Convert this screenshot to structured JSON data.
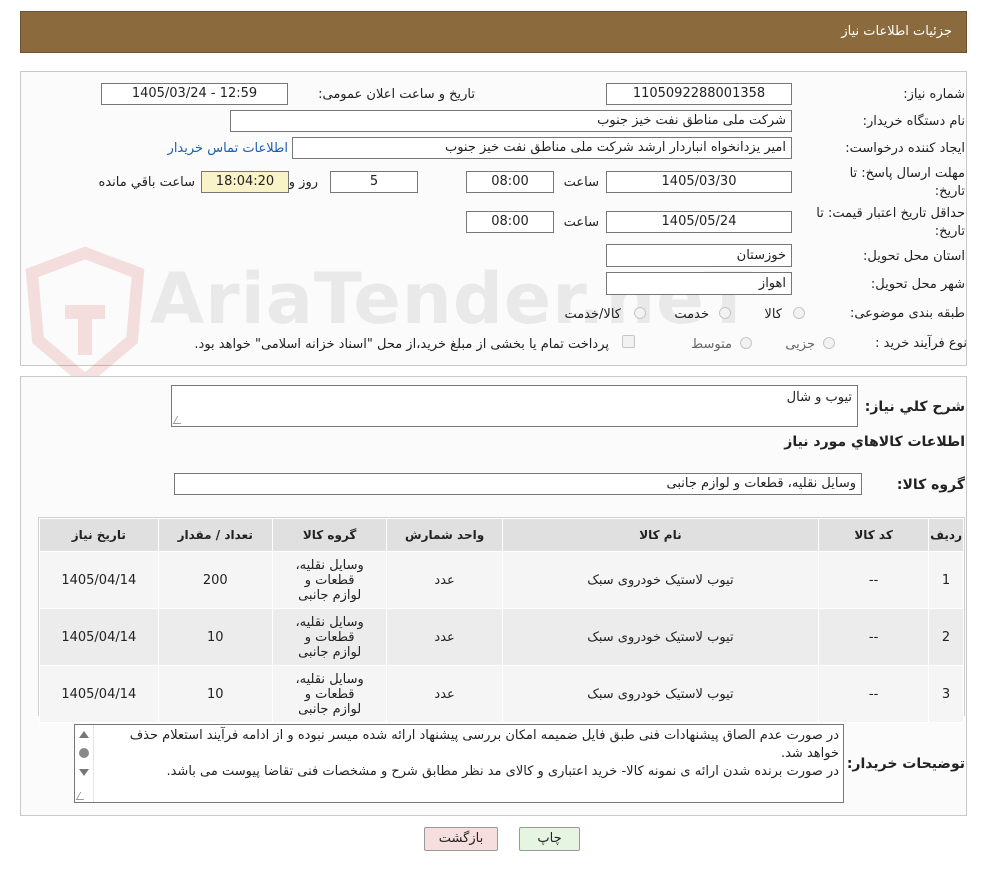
{
  "header": {
    "title": "جزئیات اطلاعات نیاز"
  },
  "fields": {
    "need_number_label": "شماره نیاز:",
    "need_number": "1105092288001358",
    "announce_label": "تاریخ و ساعت اعلان عمومی:",
    "announce_value": "1405/03/24 - 12:59",
    "buyer_label": "نام دستگاه خریدار:",
    "buyer_value": "شرکت ملی مناطق نفت خیز جنوب",
    "creator_label": "ایجاد کننده درخواست:",
    "creator_value": "امیر یزدانخواه انباردار ارشد شرکت ملی مناطق نفت خیز جنوب",
    "contact_link": "اطلاعات تماس خریدار",
    "deadline_label_1": "مهلت ارسال پاسخ: تا",
    "deadline_label_2": "تاریخ:",
    "deadline_date": "1405/03/30",
    "time_label": "ساعت",
    "deadline_time": "08:00",
    "days_value": "5",
    "days_label": "روز و",
    "remaining_time": "18:04:20",
    "remaining_label": "ساعت باقي مانده",
    "price_label_1": "حداقل تاریخ اعتبار قیمت: تا",
    "price_label_2": "تاریخ:",
    "price_date": "1405/05/24",
    "price_time": "08:00",
    "province_label": "استان محل تحویل:",
    "province_value": "خوزستان",
    "city_label": "شهر محل تحویل:",
    "city_value": "اهواز",
    "category_label": "طبقه بندی موضوعی:",
    "category_options": [
      "کالا",
      "خدمت",
      "کالا/خدمت"
    ],
    "process_label": "نوع فرآیند خرید :",
    "process_options": [
      "جزیی",
      "متوسط"
    ],
    "payment_note": "پرداخت تمام یا بخشی از مبلغ خرید،از محل \"اسناد خزانه اسلامی\" خواهد بود."
  },
  "summary": {
    "label": "شرح كلي نياز:",
    "value": "تیوب و شال",
    "goods_heading": "اطلاعات كالاهاي مورد نياز",
    "group_label": "گروه كالا:",
    "group_value": "وسایل نقلیه، قطعات و لوازم جانبی"
  },
  "table": {
    "headers": [
      "رديف",
      "کد کالا",
      "نام کالا",
      "واحد شمارش",
      "گروه کالا",
      "تعداد / مقدار",
      "تاریخ نیاز"
    ],
    "rows": [
      [
        "1",
        "--",
        "تیوب لاستیک خودروی سبک",
        "عدد",
        "وسایل نقلیه، قطعات و لوازم جانبی",
        "200",
        "1405/04/14"
      ],
      [
        "2",
        "--",
        "تیوب لاستیک خودروی سبک",
        "عدد",
        "وسایل نقلیه، قطعات و لوازم جانبی",
        "10",
        "1405/04/14"
      ],
      [
        "3",
        "--",
        "تیوب لاستیک خودروی سبک",
        "عدد",
        "وسایل نقلیه، قطعات و لوازم جانبی",
        "10",
        "1405/04/14"
      ]
    ]
  },
  "notes": {
    "label": "توضیحات خریدار:",
    "text": "در صورت عدم الصاق پیشنهادات فنی طبق فایل ضمیمه امکان بررسی پیشنهاد ارائه شده میسر نبوده و از ادامه فرآیند استعلام حذف خواهد شد.\nدر صورت برنده شدن ارائه ی نمونه کالا- خرید اعتباری و کالای مد نظر مطابق شرح و مشخصات فنی تقاضا پیوست می باشد."
  },
  "buttons": {
    "print": "چاپ",
    "back": "بازگشت"
  },
  "watermark": {
    "text": "AriaTender.neT"
  },
  "colors": {
    "header": "#8b6a3e",
    "back_button": "#f6dede",
    "print_button": "#e6f4e2",
    "link": "#1a5fb4"
  }
}
